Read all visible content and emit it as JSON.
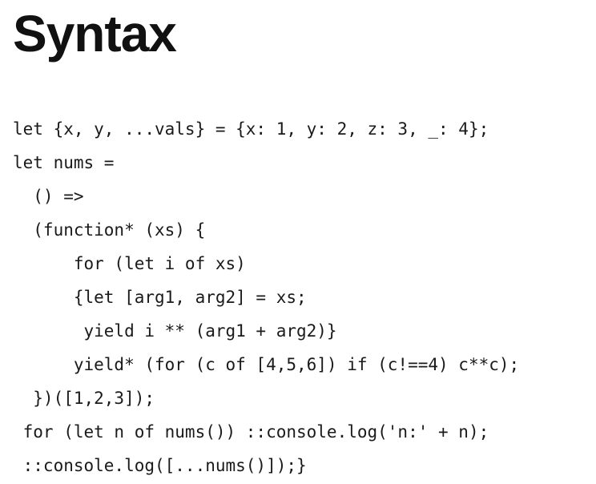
{
  "slide": {
    "title": "Syntax",
    "code_lines": [
      {
        "indent": 0,
        "text": "let {x, y, ...vals} = {x: 1, y: 2, z: 3, _: 4};"
      },
      {
        "indent": 0,
        "text": "let nums ="
      },
      {
        "indent": 2,
        "text": "() =>"
      },
      {
        "indent": 2,
        "text": "(function* (xs) {"
      },
      {
        "indent": 6,
        "text": "for (let i of xs)"
      },
      {
        "indent": 6,
        "text": "{let [arg1, arg2] = xs;"
      },
      {
        "indent": 7,
        "text": "yield i ** (arg1 + arg2)}"
      },
      {
        "indent": 6,
        "text": "yield* (for (c of [4,5,6]) if (c!==4) c**c);"
      },
      {
        "indent": 2,
        "text": "})([1,2,3]);"
      },
      {
        "indent": 1,
        "text": "for (let n of nums()) ::console.log('n:' + n);"
      },
      {
        "indent": 1,
        "text": "::console.log([...nums()]);}"
      }
    ]
  }
}
